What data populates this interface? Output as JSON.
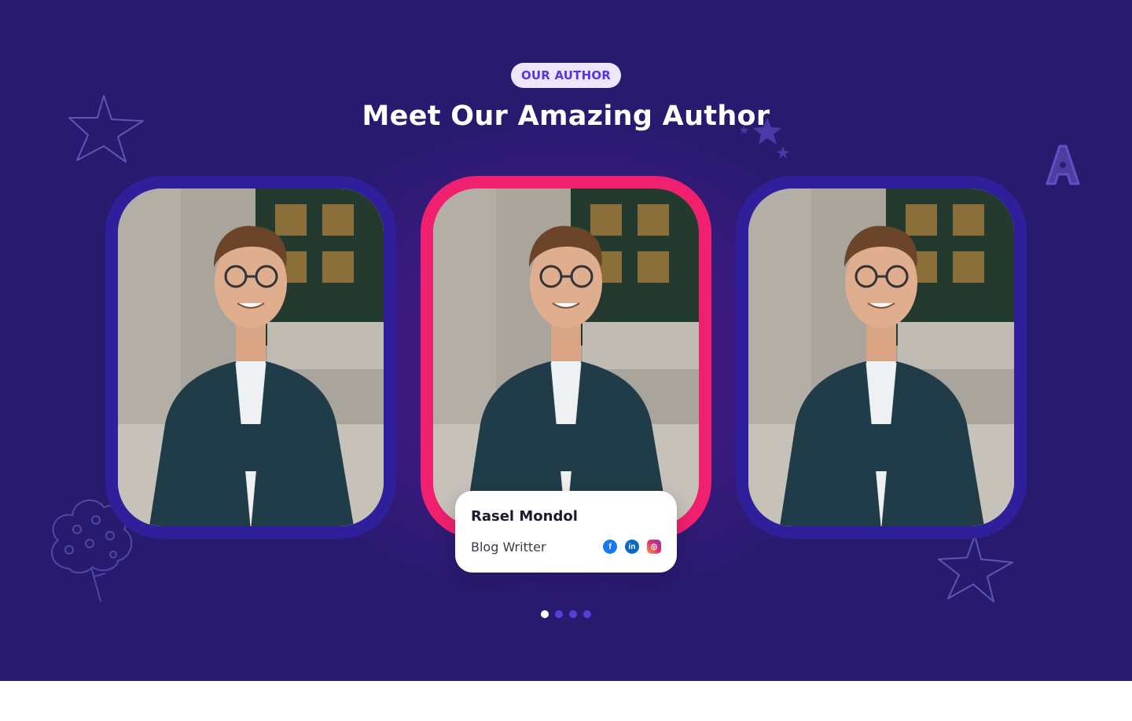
{
  "section": {
    "badge": "OUR AUTHOR",
    "title": "Meet Our Amazing Author"
  },
  "authors": [
    {
      "photo_alt": "Author portrait",
      "active": false
    },
    {
      "photo_alt": "Author portrait",
      "active": true
    },
    {
      "photo_alt": "Author portrait",
      "active": false
    }
  ],
  "featured": {
    "name": "Rasel Mondol",
    "role": "Blog Writter",
    "socials": [
      {
        "name": "facebook-icon",
        "glyph": "f"
      },
      {
        "name": "linkedin-icon",
        "glyph": "in"
      },
      {
        "name": "instagram-icon",
        "glyph": "◎"
      }
    ]
  },
  "pagination": {
    "total": 4,
    "current": 1
  },
  "colors": {
    "background": "#271a6f",
    "card_side": "#2f1f9a",
    "card_active": "#f0206e",
    "badge_bg": "#ece7ff",
    "badge_text": "#5b32e8"
  }
}
